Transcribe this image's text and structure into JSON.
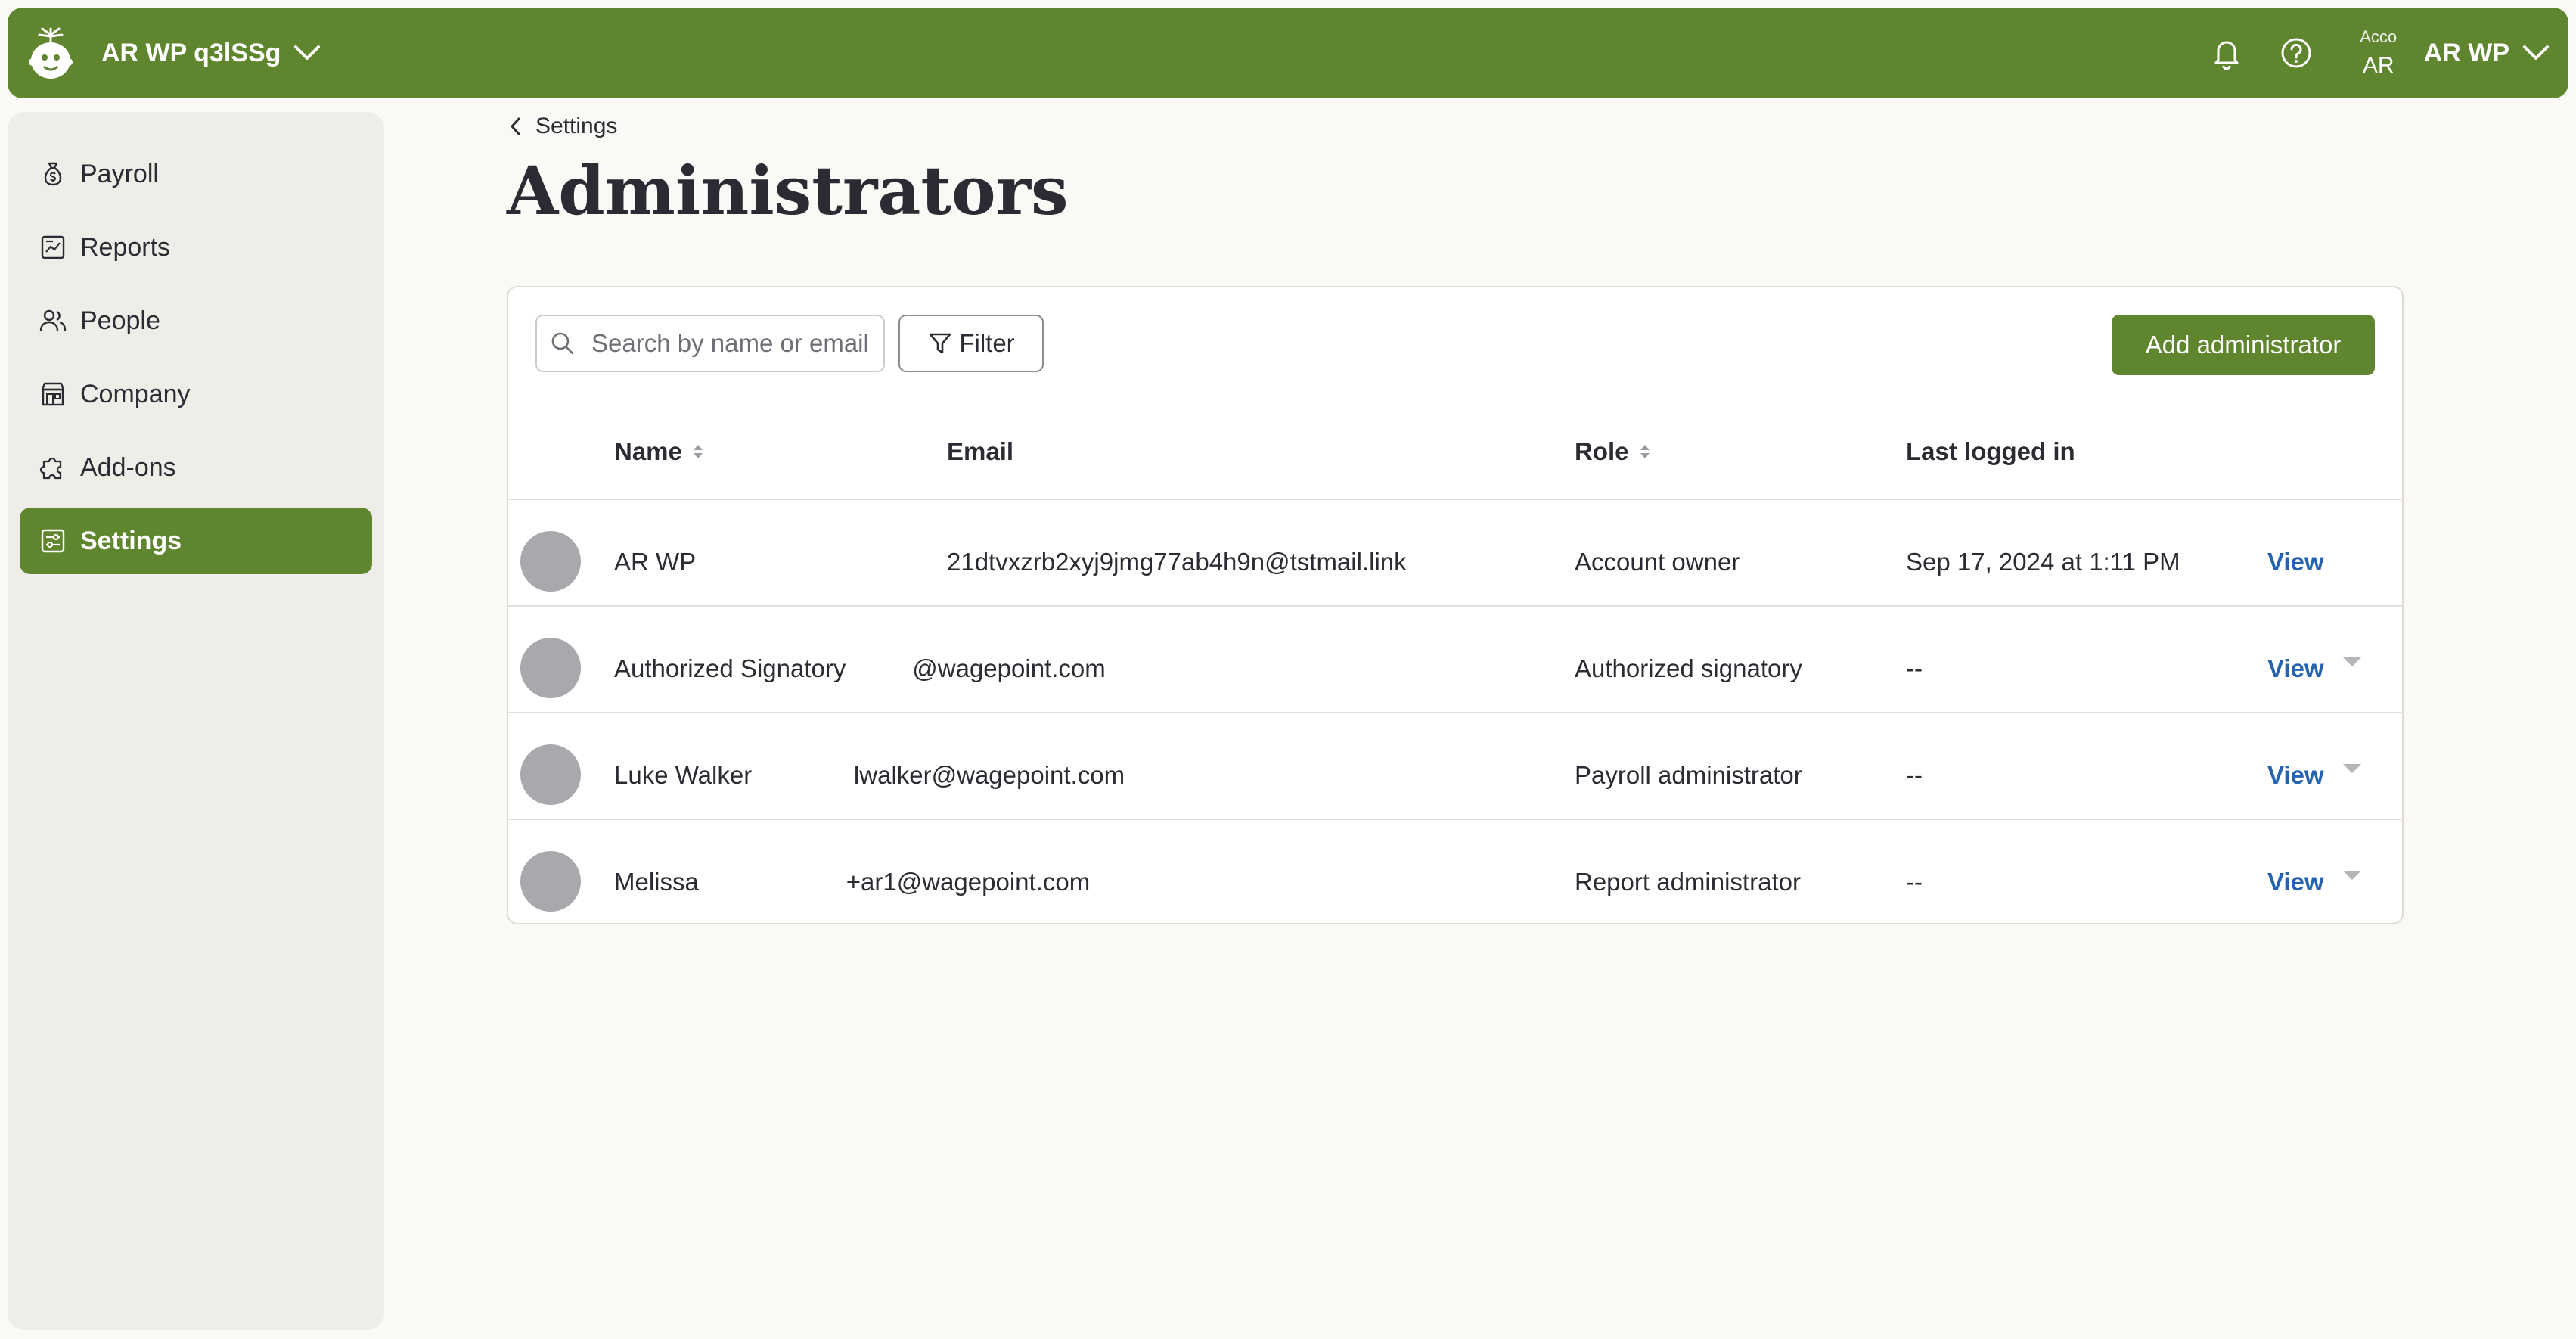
{
  "topbar": {
    "org_name": "AR WP q3lSSg",
    "avatar_broken_text": "Acco",
    "avatar_initials": "AR",
    "user_name": "AR WP"
  },
  "sidebar": {
    "items": [
      {
        "label": "Payroll",
        "icon": "money-bag-icon"
      },
      {
        "label": "Reports",
        "icon": "report-icon"
      },
      {
        "label": "People",
        "icon": "people-icon"
      },
      {
        "label": "Company",
        "icon": "store-icon"
      },
      {
        "label": "Add-ons",
        "icon": "puzzle-icon"
      },
      {
        "label": "Settings",
        "icon": "settings-sliders-icon",
        "active": true
      }
    ]
  },
  "breadcrumb": {
    "label": "Settings"
  },
  "page": {
    "title": "Administrators"
  },
  "toolbar": {
    "search_placeholder": "Search by name or email",
    "filter_label": "Filter",
    "add_label": "Add administrator"
  },
  "table": {
    "columns": {
      "name": "Name",
      "email": "Email",
      "role": "Role",
      "last_logged_in": "Last logged in"
    },
    "rows": [
      {
        "name": "AR WP",
        "email": "21dtvxzrb2xyj9jmg77ab4h9n@tstmail.link",
        "role": "Account owner",
        "last": "Sep 17, 2024 at 1:11 PM",
        "action": "View",
        "has_menu": false
      },
      {
        "name": "Authorized Signatory",
        "email": "@wagepoint.com",
        "role": "Authorized signatory",
        "last": "--",
        "action": "View",
        "has_menu": true
      },
      {
        "name": "Luke Walker",
        "email": "lwalker@wagepoint.com",
        "role": "Payroll administrator",
        "last": "--",
        "action": "View",
        "has_menu": true
      },
      {
        "name": "Melissa",
        "email": "+ar1@wagepoint.com",
        "role": "Report administrator",
        "last": "--",
        "action": "View",
        "has_menu": true
      }
    ]
  },
  "colors": {
    "brand_green": "#5f852e",
    "link_blue": "#2563b0",
    "avatar_gray": "#a8a8ad"
  }
}
